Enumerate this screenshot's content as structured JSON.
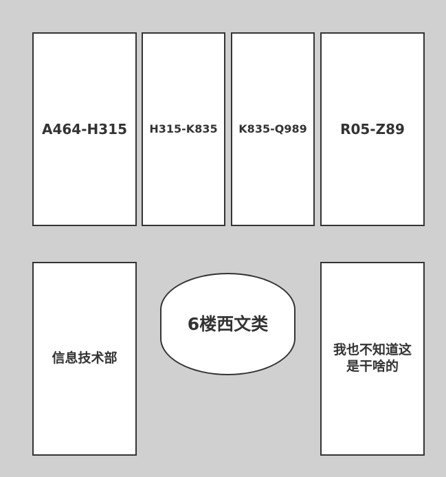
{
  "shelves": {
    "shelf_1": "A464-H315",
    "shelf_2": "H315-K835",
    "shelf_3": "K835-Q989",
    "shelf_4": "R05-Z89",
    "it_department": "信息技术部",
    "western_literature": "6楼西文类",
    "unknown_area": "我也不知道这是干啥的"
  }
}
